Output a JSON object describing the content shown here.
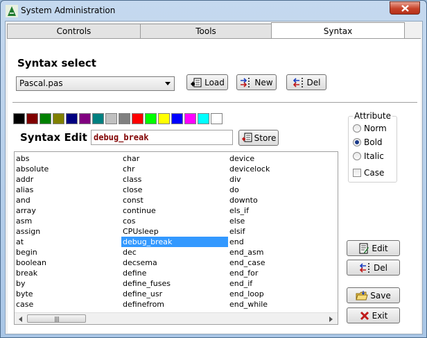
{
  "window": {
    "title": "System Administration"
  },
  "tabs": [
    {
      "label": "Controls",
      "active": false
    },
    {
      "label": "Tools",
      "active": false
    },
    {
      "label": "Syntax",
      "active": true
    }
  ],
  "syntax_select": {
    "heading": "Syntax select",
    "selected_file": "Pascal.pas",
    "load_label": "Load",
    "new_label": "New",
    "del_label": "Del"
  },
  "palette": [
    "#000000",
    "#800000",
    "#008000",
    "#808000",
    "#000080",
    "#800080",
    "#008080",
    "#c0c0c0",
    "#808080",
    "#ff0000",
    "#00ff00",
    "#ffff00",
    "#0000ff",
    "#ff00ff",
    "#00ffff",
    "#ffffff"
  ],
  "syntax_edit": {
    "heading": "Syntax Edit",
    "value": "debug_break",
    "store_label": "Store"
  },
  "keywords": {
    "col1": [
      "abs",
      "absolute",
      "addr",
      "alias",
      "and",
      "array",
      "asm",
      "assign",
      "at",
      "begin",
      "boolean",
      "break",
      "by",
      "byte",
      "case"
    ],
    "col2": [
      "char",
      "chr",
      "class",
      "close",
      "const",
      "continue",
      "cos",
      "CPUsleep",
      "debug_break",
      "dec",
      "decsema",
      "define",
      "define_fuses",
      "define_usr",
      "definefrom"
    ],
    "col3": [
      "device",
      "devicelock",
      "div",
      "do",
      "downto",
      "els_if",
      "else",
      "elsif",
      "end",
      "end_asm",
      "end_case",
      "end_for",
      "end_if",
      "end_loop",
      "end_while"
    ],
    "selected": "debug_break"
  },
  "attribute": {
    "label": "Attribute",
    "norm_label": "Norm",
    "bold_label": "Bold",
    "italic_label": "Italic",
    "case_label": "Case",
    "selected": "Bold",
    "case_checked": false
  },
  "actions": {
    "edit_label": "Edit",
    "del_label": "Del",
    "save_label": "Save",
    "exit_label": "Exit"
  }
}
